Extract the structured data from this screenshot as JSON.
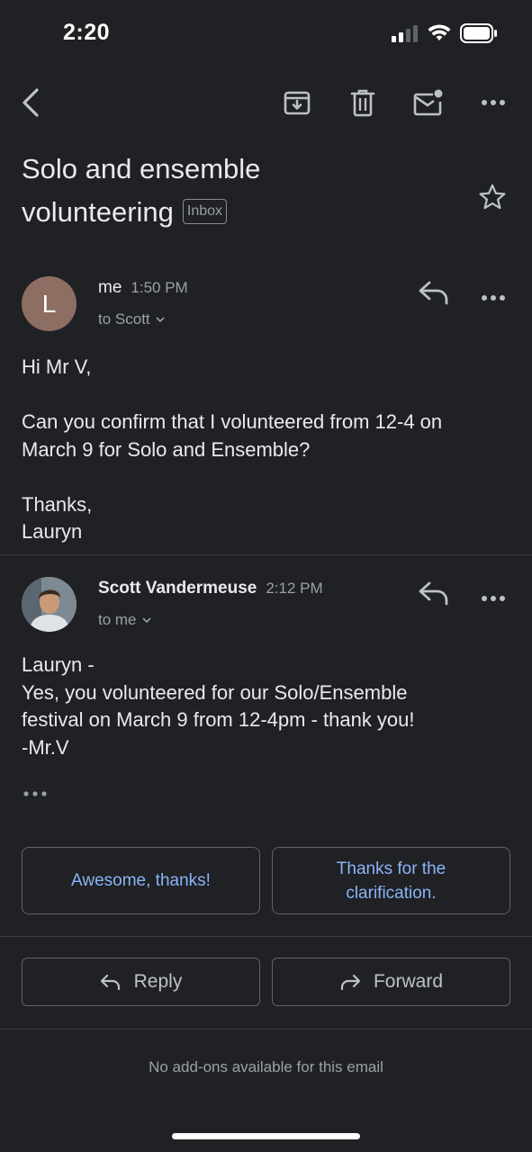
{
  "status_bar": {
    "time": "2:20"
  },
  "toolbar": {
    "back": "back-arrow-icon",
    "archive": "archive-icon",
    "delete": "trash-icon",
    "mark_unread": "mail-unread-icon",
    "more": "more-horizontal-icon"
  },
  "subject": {
    "line1": "Solo and ensemble",
    "line2": "volunteering",
    "label": "Inbox"
  },
  "messages": [
    {
      "avatar_letter": "L",
      "sender": "me",
      "time": "1:50 PM",
      "to": "to Scott",
      "body": [
        "Hi Mr V,",
        "Can you confirm that I volunteered from 12-4 on",
        "March 9 for Solo and Ensemble?",
        "Thanks,",
        "Lauryn"
      ]
    },
    {
      "sender": "Scott Vandermeuse",
      "time": "2:12 PM",
      "to": "to me",
      "body": [
        "Lauryn -",
        "Yes, you volunteered for our Solo/Ensemble",
        "festival on March 9 from 12-4pm - thank you!",
        "-Mr.V"
      ]
    }
  ],
  "smart_replies": [
    "Awesome, thanks!",
    "Thanks for the clarification."
  ],
  "actions": {
    "reply": "Reply",
    "forward": "Forward"
  },
  "footer": {
    "addons": "No add-ons available for this email"
  },
  "colors": {
    "background": "#202124",
    "accent": "#8ab4f8",
    "avatar": "#8d6e63"
  }
}
